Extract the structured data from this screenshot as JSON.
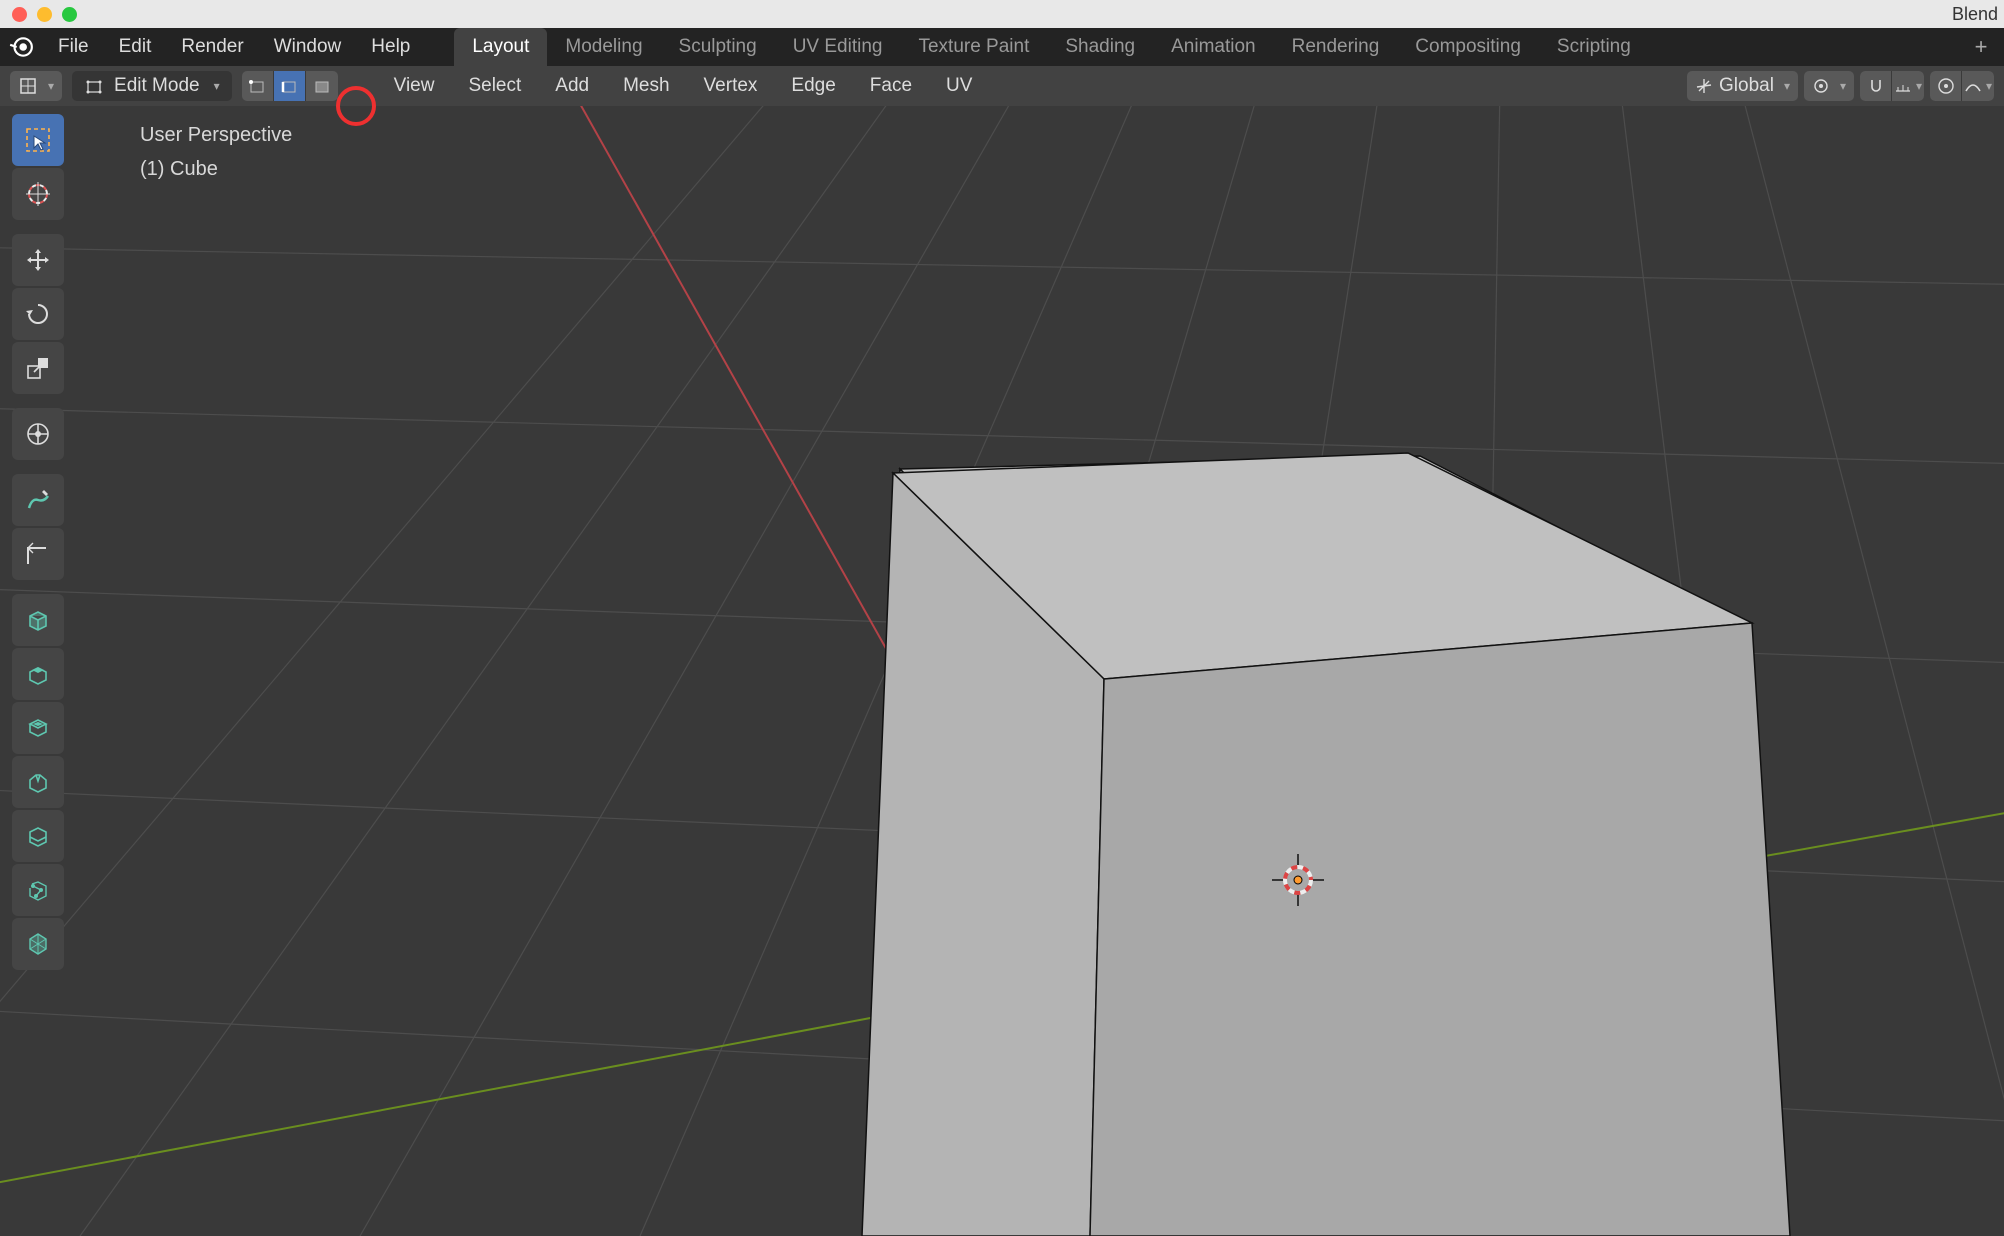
{
  "app": {
    "title": "Blend"
  },
  "menubar": {
    "items": [
      "File",
      "Edit",
      "Render",
      "Window",
      "Help"
    ]
  },
  "workspaces": {
    "tabs": [
      "Layout",
      "Modeling",
      "Sculpting",
      "UV Editing",
      "Texture Paint",
      "Shading",
      "Animation",
      "Rendering",
      "Compositing",
      "Scripting"
    ],
    "active": 0
  },
  "header": {
    "mode_label": "Edit Mode",
    "select_modes": [
      "Vertex",
      "Edge",
      "Face"
    ],
    "select_mode_active": 1,
    "menus": [
      "View",
      "Select",
      "Add",
      "Mesh",
      "Vertex",
      "Edge",
      "Face",
      "UV"
    ],
    "orientation": "Global"
  },
  "viewport": {
    "line1": "User Perspective",
    "line2": "(1) Cube"
  },
  "tools": [
    {
      "id": "select-box",
      "active": true
    },
    {
      "id": "cursor"
    },
    {
      "id": "move"
    },
    {
      "id": "rotate"
    },
    {
      "id": "scale",
      "gap_after": true
    },
    {
      "id": "transform"
    },
    {
      "id": "annotate"
    },
    {
      "id": "measure",
      "gap_after": true
    },
    {
      "id": "add-cube"
    },
    {
      "id": "extrude"
    },
    {
      "id": "inset"
    },
    {
      "id": "bevel"
    },
    {
      "id": "loop-cut"
    },
    {
      "id": "knife"
    },
    {
      "id": "poly-build"
    }
  ]
}
